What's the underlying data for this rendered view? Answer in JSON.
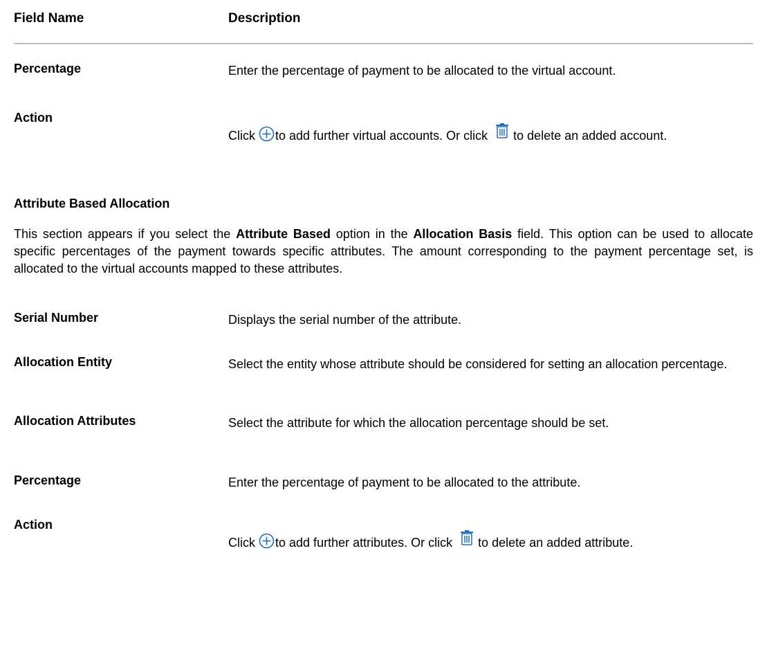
{
  "table_header": {
    "field_name": "Field Name",
    "description": "Description"
  },
  "rows_top": [
    {
      "name": "Percentage",
      "description": "Enter the percentage of payment to be allocated to the virtual account."
    },
    {
      "name": "Action",
      "desc_click": "Click",
      "desc_middle": "to add further virtual accounts. Or click",
      "desc_end": "to delete an added account.",
      "icons": [
        "add-circle-icon",
        "trash-icon"
      ]
    }
  ],
  "section": {
    "title": "Attribute Based Allocation",
    "para_1": "This section appears if you select the ",
    "para_bold_1": "Attribute Based",
    "para_2": " option in the ",
    "para_bold_2": "Allocation Basis",
    "para_3": " field. This option can be used to allocate specific percentages of the payment towards specific attributes. The amount corresponding to the payment percentage set, is allocated to the virtual accounts mapped to these attributes."
  },
  "rows_bottom": [
    {
      "name": "Serial Number",
      "description": "Displays the serial number of the attribute."
    },
    {
      "name": "Allocation Entity",
      "description": "Select the entity whose attribute should be considered for setting an allocation percentage."
    },
    {
      "name": "Allocation Attributes",
      "description": "Select the attribute for which the allocation percentage should be set."
    },
    {
      "name": "Percentage",
      "description": "Enter the percentage of payment to be allocated to the attribute."
    },
    {
      "name": "Action",
      "desc_click": "Click",
      "desc_middle": "to add further attributes. Or click",
      "desc_end": "to delete an added attribute.",
      "icons": [
        "add-circle-icon",
        "trash-icon"
      ]
    }
  ],
  "colors": {
    "icon_blue": "#1f6fc0",
    "rule_gray": "#bfbfbf"
  }
}
